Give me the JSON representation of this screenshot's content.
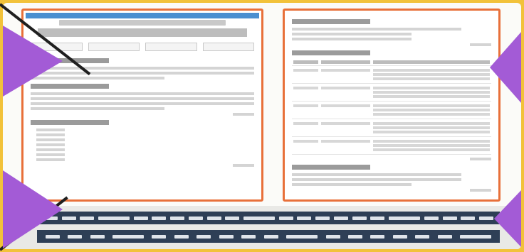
{
  "left_page": {
    "lines_a": 3,
    "lines_b": 4,
    "list_items": 7
  },
  "right_page": {
    "table_rows": 5
  },
  "bottom": {
    "strip1_dashes": 22,
    "strip2_dashes": 18
  }
}
